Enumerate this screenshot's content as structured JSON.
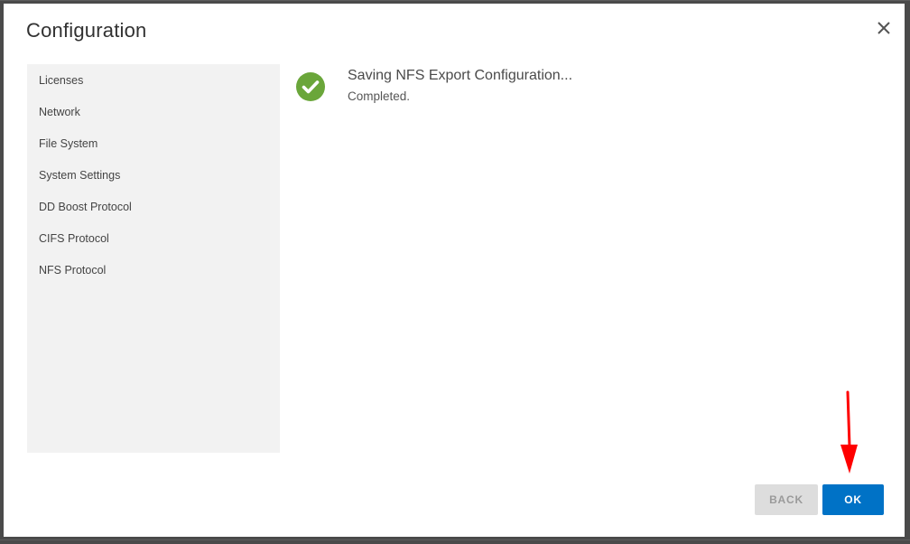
{
  "dialog": {
    "title": "Configuration",
    "close_icon": "close-icon"
  },
  "sidebar": {
    "items": [
      {
        "label": "Licenses"
      },
      {
        "label": "Network"
      },
      {
        "label": "File System"
      },
      {
        "label": "System Settings"
      },
      {
        "label": "DD Boost Protocol"
      },
      {
        "label": "CIFS Protocol"
      },
      {
        "label": "NFS Protocol"
      }
    ]
  },
  "status": {
    "icon": "check-circle-icon",
    "icon_color": "#6aa63a",
    "title": "Saving NFS Export Configuration...",
    "message": "Completed."
  },
  "footer": {
    "back_label": "BACK",
    "ok_label": "OK",
    "ok_color": "#0072c6"
  },
  "annotation": {
    "arrow_color": "#ff0000"
  }
}
